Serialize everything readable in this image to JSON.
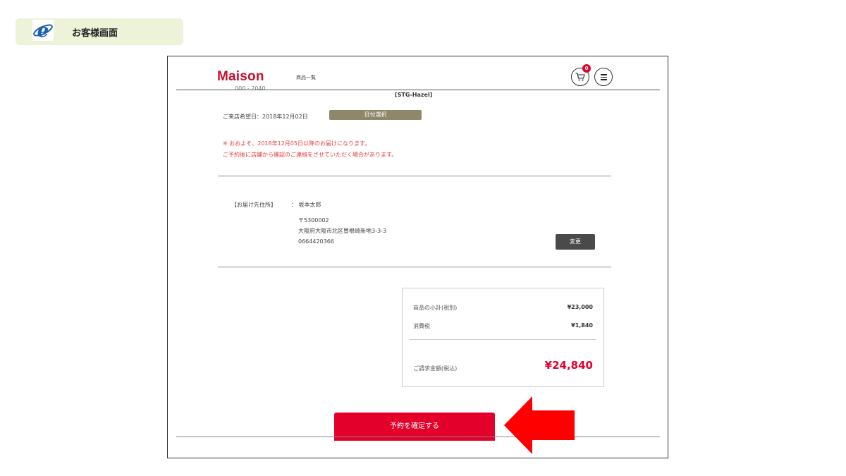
{
  "header": {
    "title": "お客様画面",
    "icon": "internet-explorer-icon"
  },
  "site": {
    "logo": "Maison",
    "nav_link": "商品一覧",
    "cart_count": "0",
    "cart_icon": "cart-icon",
    "menu_icon": "menu-icon"
  },
  "product": {
    "cut_text": "000 - 2040",
    "code": "[STG-Hazel]"
  },
  "visit": {
    "label": "ご来店希望日：2018年12月02日",
    "date_button": "日付選択"
  },
  "notice": {
    "line1": "※ おおよそ、2018年12月05日以降のお届けになります。",
    "line2": "ご予約後に店舗から確認のご連絡をさせていただく場合があります。"
  },
  "address": {
    "label": "【お届け先住所】",
    "name": "：  坂本太郎",
    "postal": "〒5300002",
    "street": "大阪府大阪市北区曽根崎新地3-3-3",
    "phone": "0664420366",
    "change_button": "変更"
  },
  "summary": {
    "subtotal_label": "商品の小計(税別)",
    "subtotal_value": "¥23,000",
    "tax_label": "消費税",
    "tax_value": "¥1,840",
    "total_label": "ご請求金額(税込)",
    "total_value": "¥24,840"
  },
  "confirm_button": "予約を確定する",
  "colors": {
    "brand_red": "#e3002b",
    "date_button": "#8f8769",
    "change_button": "#4a4a4a",
    "arrow": "#ff0000"
  }
}
